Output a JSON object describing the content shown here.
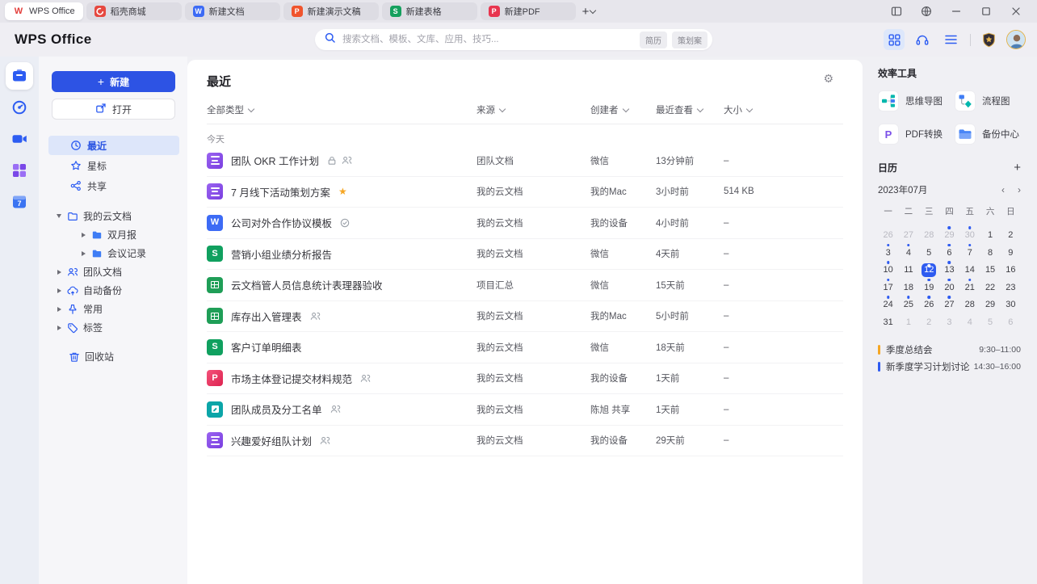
{
  "window": {
    "tabs": [
      {
        "label": "WPS Office",
        "icon": "wps-logo",
        "active": true
      },
      {
        "label": "稻壳商城",
        "icon": "docer",
        "active": false
      },
      {
        "label": "新建文档",
        "icon": "writer",
        "active": false
      },
      {
        "label": "新建演示文稿",
        "icon": "presentation",
        "active": false
      },
      {
        "label": "新建表格",
        "icon": "spreadsheet",
        "active": false
      },
      {
        "label": "新建PDF",
        "icon": "pdf",
        "active": false
      }
    ],
    "new_tab_icon": "plus-icon",
    "controls": [
      "split-view-icon",
      "globe-icon",
      "minimize-icon",
      "maximize-icon",
      "close-icon"
    ]
  },
  "header": {
    "logo_text": "WPS Office",
    "search_placeholder": "搜索文档、模板、文库、应用、技巧...",
    "search_icon": "search-icon",
    "search_tags": [
      "简历",
      "策划案"
    ],
    "right_icons": [
      "apps-grid-icon",
      "headset-icon",
      "hamburger-icon",
      "vip-badge-icon",
      "avatar"
    ]
  },
  "rail": {
    "items": [
      {
        "name": "documents",
        "icon": "documents-icon",
        "active": true
      },
      {
        "name": "schedule",
        "icon": "clock-compass-icon",
        "active": false
      },
      {
        "name": "meeting",
        "icon": "video-camera-icon",
        "active": false
      },
      {
        "name": "apps",
        "icon": "apps-squares-icon",
        "active": false
      },
      {
        "name": "calendar",
        "icon": "calendar-7-icon",
        "active": false
      }
    ]
  },
  "sidebar": {
    "new_label": "新建",
    "open_label": "打开",
    "nav": [
      {
        "label": "最近",
        "icon": "clock-icon",
        "active": true
      },
      {
        "label": "星标",
        "icon": "star-icon",
        "active": false
      },
      {
        "label": "共享",
        "icon": "share-icon",
        "active": false
      }
    ],
    "tree": [
      {
        "label": "我的云文档",
        "icon": "folder-outline-icon",
        "expanded": true,
        "children": [
          {
            "label": "双月报",
            "icon": "folder-filled-icon"
          },
          {
            "label": "会议记录",
            "icon": "folder-filled-icon"
          }
        ]
      },
      {
        "label": "团队文档",
        "icon": "team-icon",
        "expanded": false,
        "children": []
      },
      {
        "label": "自动备份",
        "icon": "cloud-backup-icon",
        "expanded": false,
        "children": []
      },
      {
        "label": "常用",
        "icon": "pin-icon",
        "expanded": false,
        "children": []
      },
      {
        "label": "标签",
        "icon": "tag-icon",
        "expanded": false,
        "children": []
      }
    ],
    "trash_label": "回收站",
    "trash_icon": "trash-icon"
  },
  "main": {
    "title": "最近",
    "settings_icon": "gear-icon",
    "filters": [
      {
        "label": "全部类型"
      },
      {
        "label": "来源"
      },
      {
        "label": "创建者"
      },
      {
        "label": "最近查看"
      },
      {
        "label": "大小"
      }
    ],
    "group_label": "今天",
    "files": [
      {
        "name": "团队 OKR 工作计划",
        "type": "docs",
        "badges": [
          "lock",
          "members"
        ],
        "source": "团队文档",
        "creator": "微信",
        "viewed": "13分钟前",
        "size": "–"
      },
      {
        "name": "7 月线下活动策划方案",
        "type": "docs",
        "badges": [
          "star"
        ],
        "source": "我的云文档",
        "creator": "我的Mac",
        "viewed": "3小时前",
        "size": "514 KB"
      },
      {
        "name": "公司对外合作协议模板",
        "type": "writer",
        "badges": [
          "template"
        ],
        "source": "我的云文档",
        "creator": "我的设备",
        "viewed": "4小时前",
        "size": "–"
      },
      {
        "name": "营销小组业绩分析报告",
        "type": "sheet",
        "badges": [],
        "source": "我的云文档",
        "creator": "微信",
        "viewed": "4天前",
        "size": "–"
      },
      {
        "name": "云文档管人员信息统计表理器验收",
        "type": "table",
        "badges": [],
        "source": "项目汇总",
        "creator": "微信",
        "viewed": "15天前",
        "size": "–"
      },
      {
        "name": "库存出入管理表",
        "type": "table",
        "badges": [
          "members"
        ],
        "source": "我的云文档",
        "creator": "我的Mac",
        "viewed": "5小时前",
        "size": "–"
      },
      {
        "name": "客户订单明细表",
        "type": "sheet",
        "badges": [],
        "source": "我的云文档",
        "creator": "微信",
        "viewed": "18天前",
        "size": "–"
      },
      {
        "name": "市场主体登记提交材料规范",
        "type": "pdf",
        "badges": [
          "members"
        ],
        "source": "我的云文档",
        "creator": "我的设备",
        "viewed": "1天前",
        "size": "–"
      },
      {
        "name": "团队成员及分工名单",
        "type": "form",
        "badges": [
          "members"
        ],
        "source": "我的云文档",
        "creator": "陈旭 共享",
        "viewed": "1天前",
        "size": "–"
      },
      {
        "name": "兴趣爱好组队计划",
        "type": "docs",
        "badges": [
          "members"
        ],
        "source": "我的云文档",
        "creator": "我的设备",
        "viewed": "29天前",
        "size": "–"
      }
    ]
  },
  "tools": {
    "title": "效率工具",
    "items": [
      {
        "label": "思维导图",
        "icon": "mindmap-icon"
      },
      {
        "label": "流程图",
        "icon": "flowchart-icon"
      },
      {
        "label": "PDF转换",
        "icon": "pdf-convert-icon"
      },
      {
        "label": "备份中心",
        "icon": "backup-folder-icon"
      }
    ]
  },
  "calendar": {
    "title": "日历",
    "add_icon": "plus-icon",
    "month_label": "2023年07月",
    "prev_icon": "chevron-left-icon",
    "next_icon": "chevron-right-icon",
    "weekdays": [
      "一",
      "二",
      "三",
      "四",
      "五",
      "六",
      "日"
    ],
    "days": [
      {
        "d": "26",
        "muted": true
      },
      {
        "d": "27",
        "muted": true
      },
      {
        "d": "28",
        "muted": true
      },
      {
        "d": "29",
        "muted": true,
        "dot": true
      },
      {
        "d": "30",
        "muted": true,
        "dot": true
      },
      {
        "d": "1"
      },
      {
        "d": "2"
      },
      {
        "d": "3",
        "dot": true
      },
      {
        "d": "4",
        "dot": true
      },
      {
        "d": "5"
      },
      {
        "d": "6",
        "dot": true
      },
      {
        "d": "7",
        "dot": true
      },
      {
        "d": "8"
      },
      {
        "d": "9"
      },
      {
        "d": "10",
        "dot": true
      },
      {
        "d": "11"
      },
      {
        "d": "12",
        "selected": true,
        "dot": true
      },
      {
        "d": "13",
        "dot": true
      },
      {
        "d": "14"
      },
      {
        "d": "15"
      },
      {
        "d": "16"
      },
      {
        "d": "17",
        "dot": true
      },
      {
        "d": "18"
      },
      {
        "d": "19",
        "dot": true
      },
      {
        "d": "20",
        "dot": true
      },
      {
        "d": "21",
        "dot": true
      },
      {
        "d": "22"
      },
      {
        "d": "23"
      },
      {
        "d": "24",
        "dot": true
      },
      {
        "d": "25",
        "dot": true
      },
      {
        "d": "26",
        "dot": true
      },
      {
        "d": "27",
        "dot": true
      },
      {
        "d": "28"
      },
      {
        "d": "29"
      },
      {
        "d": "30"
      },
      {
        "d": "31"
      },
      {
        "d": "1",
        "muted": true
      },
      {
        "d": "2",
        "muted": true
      },
      {
        "d": "3",
        "muted": true
      },
      {
        "d": "4",
        "muted": true
      },
      {
        "d": "5",
        "muted": true
      },
      {
        "d": "6",
        "muted": true
      }
    ],
    "events": [
      {
        "label": "季度总结会",
        "time": "9:30–11:00",
        "color": "#f5a623"
      },
      {
        "label": "新季度学习计划讨论",
        "time": "14:30–16:00",
        "color": "#2e5bf0"
      }
    ]
  },
  "colors": {
    "accent_blue": "#2d53e4",
    "selected_day": "#2e5bf0",
    "docs_purple": "#7a3fe0",
    "writer_blue": "#3d6bf5",
    "sheet_green": "#10a05f",
    "table_green": "#1f9e57",
    "pdf_red": "#dd2350",
    "form_teal": "#0ba5a8",
    "event_orange": "#f5a623",
    "star_orange": "#f6a623"
  }
}
